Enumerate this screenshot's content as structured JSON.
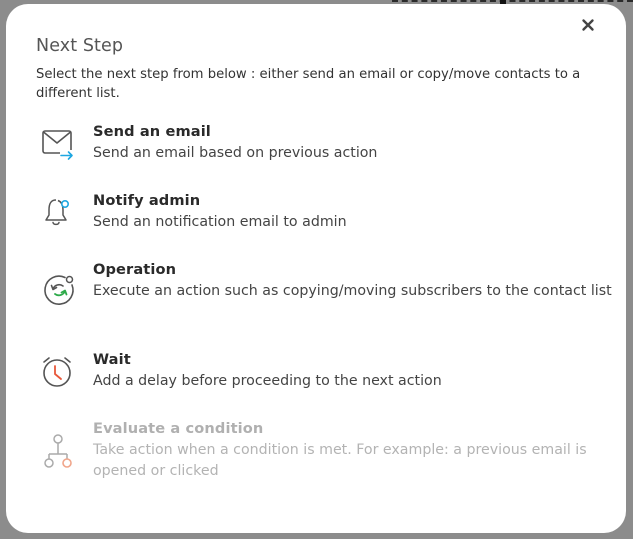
{
  "dialog": {
    "title": "Next Step",
    "description": "Select the next step from below : either send an email or copy/move contacts to a different list.",
    "close_label": "×"
  },
  "options": [
    {
      "title": "Send an email",
      "description": "Send an email based on previous action",
      "icon": "mail-send-icon",
      "enabled": true
    },
    {
      "title": "Notify admin",
      "description": "Send an notification email to admin",
      "icon": "bell-notify-icon",
      "enabled": true
    },
    {
      "title": "Operation",
      "description": "Execute an action such as copying/moving subscribers to the contact list",
      "icon": "operation-cycle-icon",
      "enabled": true
    },
    {
      "title": "Wait",
      "description": "Add a delay before proceeding to the next action",
      "icon": "alarm-clock-icon",
      "enabled": true
    },
    {
      "title": "Evaluate a condition",
      "description": "Take action when a condition is met. For example: a previous email is opened or clicked",
      "icon": "condition-branch-icon",
      "enabled": false
    }
  ],
  "colors": {
    "accent_blue": "#1ea7e1",
    "accent_green": "#2eaa4a",
    "accent_orange": "#e8573a",
    "icon_gray": "#555555"
  }
}
